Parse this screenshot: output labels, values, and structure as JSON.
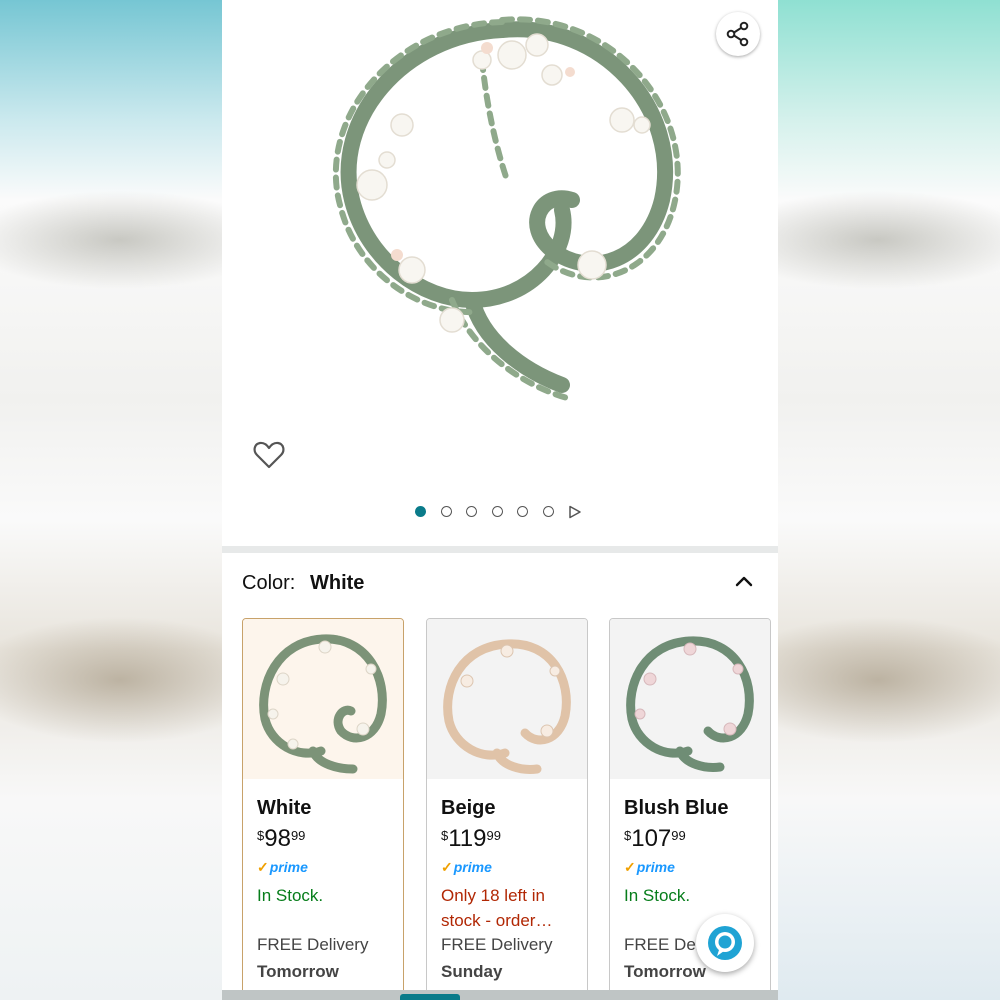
{
  "product": {
    "share_icon": "share-icon",
    "wishlist_icon": "heart-outline-icon",
    "image_count": 6,
    "active_image_index": 0
  },
  "color_selector": {
    "label": "Color:",
    "selected": "White",
    "collapse_icon": "chevron-up-icon"
  },
  "variants": [
    {
      "name": "White",
      "price_symbol": "$",
      "price_whole": "98",
      "price_fraction": "99",
      "prime": "prime",
      "stock": "In Stock.",
      "delivery": "FREE Delivery",
      "delivery_day": "Tomorrow",
      "selected": true
    },
    {
      "name": "Beige",
      "price_symbol": "$",
      "price_whole": "119",
      "price_fraction": "99",
      "prime": "prime",
      "stock": "Only 18 left in stock - order…",
      "delivery": "FREE Delivery",
      "delivery_day": "Sunday",
      "selected": false
    },
    {
      "name": "Blush Blue",
      "price_symbol": "$",
      "price_whole": "107",
      "price_fraction": "99",
      "prime": "prime",
      "stock": "In Stock.",
      "delivery": "FREE Deli",
      "delivery_day": "Tomorrow",
      "selected": false
    }
  ],
  "colors": {
    "accent": "#0a7b8a",
    "in_stock": "#067d1a",
    "low_stock": "#b12704",
    "prime": "#1a98ff"
  },
  "alexa_icon": "alexa-icon"
}
